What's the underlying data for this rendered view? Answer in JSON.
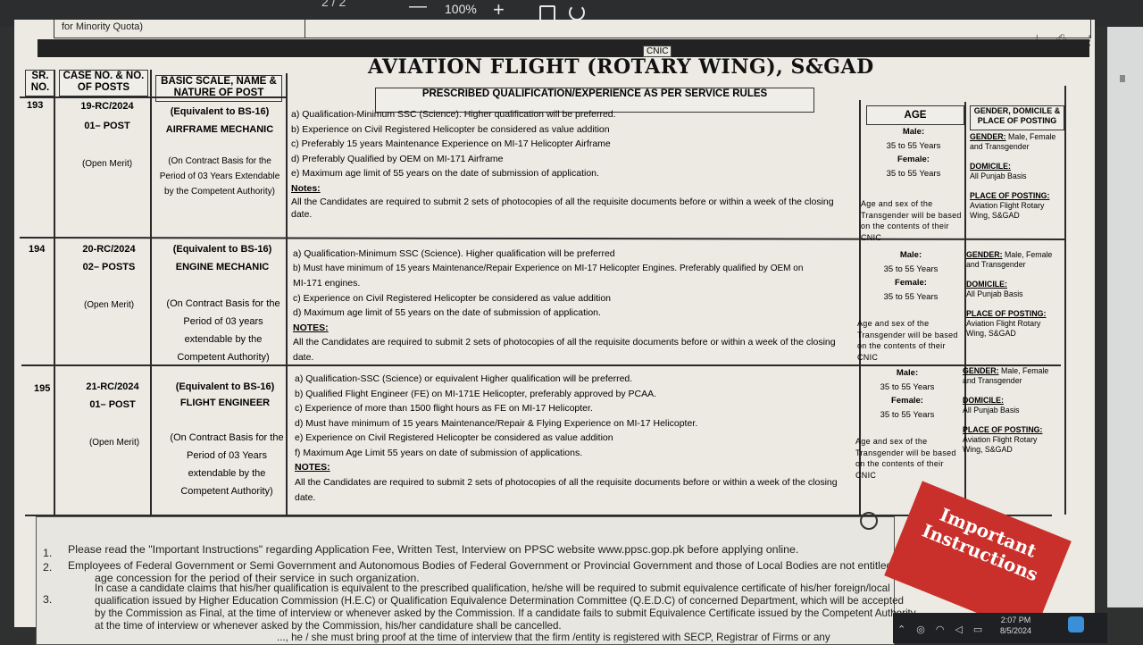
{
  "viewer": {
    "page_indicator": "2 / 2",
    "zoom": "100%",
    "minus": "—",
    "plus": "+",
    "download_icon": "download-icon",
    "print_icon": "print-icon",
    "more_icon": "more-icon"
  },
  "document": {
    "top_label": "for Minority Quota)",
    "cnic_top": "CNIC",
    "title": "AVIATION FLIGHT (ROTARY WING), S&GAD",
    "headers": {
      "sr": "SR. NO.",
      "case": "CASE NO. & NO. OF POSTS",
      "basic": "BASIC SCALE, NAME & NATURE OF POST",
      "qual": "PRESCRIBED QUALIFICATION/EXPERIENCE AS PER SERVICE RULES",
      "age": "AGE",
      "gender": "GENDER, DOMICILE & PLACE OF POSTING"
    },
    "rows": [
      {
        "sr": "193",
        "case": "19-RC/2024",
        "posts": "01– POST",
        "merit": "(Open Merit)",
        "scale": "(Equivalent to BS-16)",
        "post_name": "AIRFRAME MECHANIC",
        "contract": "(On Contract Basis for the Period of 03 Years Extendable by the Competent Authority)",
        "quals": [
          "a)  Qualification-Minimum SSC (Science).   Higher qualification will be preferred.",
          "b)  Experience on Civil Registered Helicopter be considered as value addition",
          "c)  Preferably 15 years Maintenance Experience on MI-17 Helicopter Airframe",
          "d)  Preferably Qualified by OEM on MI-171 Airframe",
          "e)  Maximum age limit of 55 years on the date of submission of application."
        ],
        "notes_label": "Notes:",
        "notes_text": "All the Candidates are required to submit 2 sets of photocopies of all the requisite documents before or within a week of the closing date.",
        "male_label": "Male:",
        "male_age": "35 to 55 Years",
        "female_label": "Female:",
        "female_age": "35 to 55 Years",
        "trans_note": "Age and sex of the Transgender will be based on the contents of their CNIC",
        "gender": "GENDER:",
        "gender_val": "Male, Female and Transgender",
        "domicile": "DOMICILE:",
        "domicile_val": "All Punjab Basis",
        "posting": "PLACE OF POSTING:",
        "posting_val": "Aviation Flight Rotary Wing, S&GAD"
      },
      {
        "sr": "194",
        "case": "20-RC/2024",
        "posts": "02– POSTS",
        "merit": "(Open Merit)",
        "scale": "(Equivalent to BS-16)",
        "post_name": "ENGINE MECHANIC",
        "contract": "(On Contract Basis for the Period of 03 years extendable by the Competent Authority)",
        "quals": [
          "a)  Qualification-Minimum SSC (Science).   Higher qualification will be preferred",
          "b)  Must have minimum of 15 years Maintenance/Repair Experience on MI-17 Helicopter Engines. Preferably qualified by OEM on",
          "      MI-171 engines.",
          "c)  Experience on Civil Registered Helicopter be considered as value addition",
          "d)  Maximum age limit of 55 years on the date of submission of application."
        ],
        "notes_label": "NOTES:",
        "notes_text": "All the Candidates are required to submit 2 sets of photocopies of all the requisite documents before or within a week of the closing date.",
        "male_label": "Male:",
        "male_age": "35 to 55 Years",
        "female_label": "Female:",
        "female_age": "35 to 55 Years",
        "trans_note": "Age and sex of the Transgender will be based on the contents of their CNIC",
        "gender": "GENDER:",
        "gender_val": "Male, Female and Transgender",
        "domicile": "DOMICILE:",
        "domicile_val": "All Punjab Basis",
        "posting": "PLACE OF POSTING:",
        "posting_val": "Aviation Flight Rotary Wing, S&GAD"
      },
      {
        "sr": "195",
        "case": "21-RC/2024",
        "posts": "01– POST",
        "merit": "(Open Merit)",
        "scale": "(Equivalent to BS-16)",
        "post_name": "FLIGHT ENGINEER",
        "contract": "(On Contract Basis for the Period of 03 Years extendable by the Competent Authority)",
        "quals": [
          "a)  Qualification-SSC (Science) or equivalent Higher qualification will be preferred.",
          "b)  Qualified Flight Engineer (FE) on MI-171E Helicopter, preferably approved by PCAA.",
          "c)  Experience of more than 1500 flight hours as FE on MI-17 Helicopter.",
          "d)  Must have minimum of 15 years Maintenance/Repair & Flying Experience on MI-17 Helicopter.",
          "e)  Experience on Civil Registered Helicopter be considered as value addition",
          "f)   Maximum Age Limit 55 years on date of submission of applications."
        ],
        "notes_label": "NOTES:",
        "notes_text": "All the Candidates are required to submit 2 sets of photocopies of all the requisite documents before or within a week of the closing date.",
        "male_label": "Male:",
        "male_age": "35 to 55 Years",
        "female_label": "Female:",
        "female_age": "35 to 55 Years",
        "trans_note": "Age and sex of the Transgender will be based on the contents of their CNIC",
        "gender": "GENDER:",
        "gender_val": "Male, Female and Transgender",
        "domicile": "DOMICILE:",
        "domicile_val": "All Punjab Basis",
        "posting": "PLACE OF POSTING:",
        "posting_val": "Aviation Flight Rotary Wing, S&GAD"
      }
    ],
    "instructions": [
      "Please read the \"Important Instructions\" regarding Application Fee, Written Test, Interview on PPSC website  www.ppsc.gop.pk  before applying online.",
      "Employees of Federal Government or Semi Government and Autonomous Bodies of Federal Government or Provincial Government and those of Local Bodies are not entitled to",
      "age concession for the period of their service in such organization.",
      "In case a candidate claims that his/her qualification is equivalent to the prescribed qualification, he/she will be required to submit equivalence certificate of his/her foreign/local",
      "qualification issued by Higher Education Commission (H.E.C) or Qualification Equivalence Determination Committee (Q.E.D.C) of concerned Department, which will be accepted",
      "by the Commission as Final, at the time of interview or whenever asked by the Commission. If a candidate fails to submit Equivalence Certificate issued by the Competent Authority",
      "at the time of interview or whenever asked by the Commission, his/her candidature shall be cancelled.",
      "..., he / she must bring proof at the time of interview that the firm /entity is registered with SECP, Registrar of Firms or any"
    ],
    "instruction_numbers": [
      "1.",
      "2.",
      "3."
    ],
    "badge_line1": "Important",
    "badge_line2": "Instructions"
  },
  "taskbar": {
    "time": "2:07 PM",
    "date": "8/5/2024"
  }
}
